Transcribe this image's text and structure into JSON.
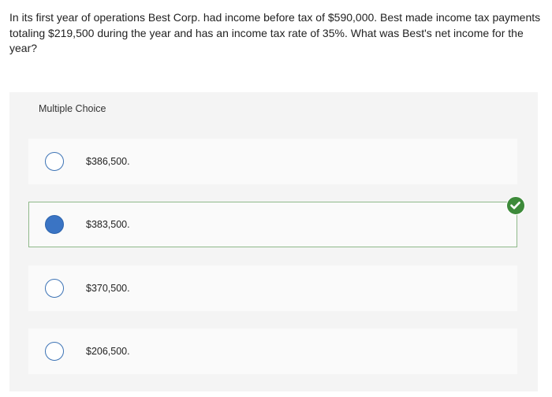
{
  "question": {
    "text": "In its first year of operations Best Corp. had income before tax of $590,000. Best made income tax payments totaling $219,500 during the year and has an income tax rate of 35%. What was Best's net income for the year?"
  },
  "multiple_choice": {
    "header": "Multiple Choice",
    "options": [
      {
        "label": "$386,500.",
        "selected": false
      },
      {
        "label": "$383,500.",
        "selected": true,
        "correct": true
      },
      {
        "label": "$370,500.",
        "selected": false
      },
      {
        "label": "$206,500.",
        "selected": false
      }
    ],
    "correct_icon": "check-circle-icon",
    "colors": {
      "radio_border": "#3c73b5",
      "radio_selected": "#3a74c4",
      "correct_green": "#3d8a3a",
      "selected_border": "#8fb98a"
    }
  }
}
